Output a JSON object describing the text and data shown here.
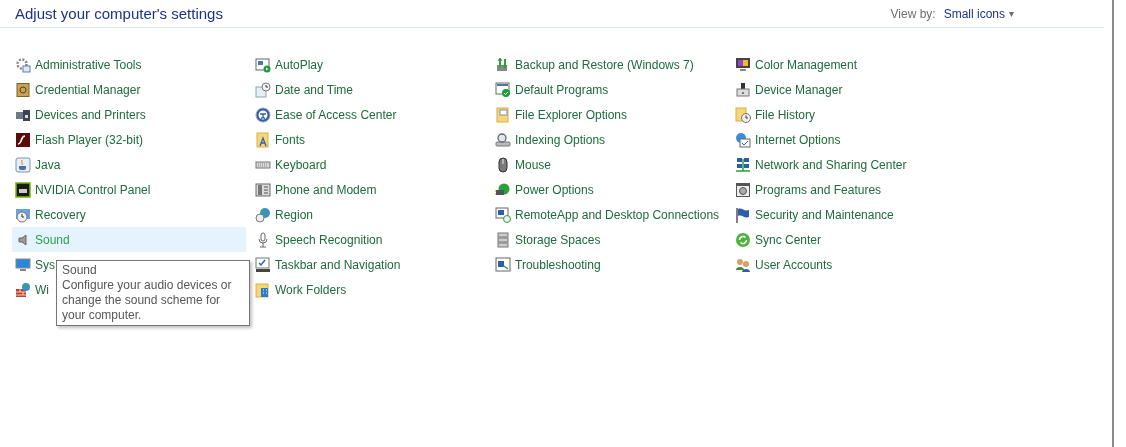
{
  "header": {
    "title": "Adjust your computer's settings",
    "view_by_label": "View by:",
    "view_by_value": "Small icons",
    "caret": "▾"
  },
  "columns": [
    {
      "items": [
        {
          "label": "Administrative Tools",
          "hovered": false
        },
        {
          "label": "Credential Manager",
          "hovered": false
        },
        {
          "label": "Devices and Printers",
          "hovered": false
        },
        {
          "label": "Flash Player (32-bit)",
          "hovered": false
        },
        {
          "label": "Java",
          "hovered": false
        },
        {
          "label": "NVIDIA Control Panel",
          "hovered": false
        },
        {
          "label": "Recovery",
          "hovered": false
        },
        {
          "label": "Sound",
          "hovered": true
        },
        {
          "label": "Sys",
          "hovered": false
        },
        {
          "label": "Wi",
          "hovered": false
        }
      ]
    },
    {
      "items": [
        {
          "label": "AutoPlay",
          "hovered": false
        },
        {
          "label": "Date and Time",
          "hovered": false
        },
        {
          "label": "Ease of Access Center",
          "hovered": false
        },
        {
          "label": "Fonts",
          "hovered": false
        },
        {
          "label": "Keyboard",
          "hovered": false
        },
        {
          "label": "Phone and Modem",
          "hovered": false
        },
        {
          "label": "Region",
          "hovered": false
        },
        {
          "label": "Speech Recognition",
          "hovered": false
        },
        {
          "label": "Taskbar and Navigation",
          "hovered": false
        },
        {
          "label": "Work Folders",
          "hovered": false
        }
      ]
    },
    {
      "items": [
        {
          "label": "Backup and Restore (Windows 7)",
          "hovered": false
        },
        {
          "label": "Default Programs",
          "hovered": false
        },
        {
          "label": "File Explorer Options",
          "hovered": false
        },
        {
          "label": "Indexing Options",
          "hovered": false
        },
        {
          "label": "Mouse",
          "hovered": false
        },
        {
          "label": "Power Options",
          "hovered": false
        },
        {
          "label": "RemoteApp and Desktop Connections",
          "hovered": false
        },
        {
          "label": "Storage Spaces",
          "hovered": false
        },
        {
          "label": "Troubleshooting",
          "hovered": false
        }
      ]
    },
    {
      "items": [
        {
          "label": "Color Management",
          "hovered": false
        },
        {
          "label": "Device Manager",
          "hovered": false
        },
        {
          "label": "File History",
          "hovered": false
        },
        {
          "label": "Internet Options",
          "hovered": false
        },
        {
          "label": "Network and Sharing Center",
          "hovered": false
        },
        {
          "label": "Programs and Features",
          "hovered": false
        },
        {
          "label": "Security and Maintenance",
          "hovered": false
        },
        {
          "label": "Sync Center",
          "hovered": false
        },
        {
          "label": "User Accounts",
          "hovered": false
        }
      ]
    }
  ],
  "tooltip": {
    "title": "Sound",
    "text": "Configure your audio devices or change the sound scheme for your computer."
  }
}
